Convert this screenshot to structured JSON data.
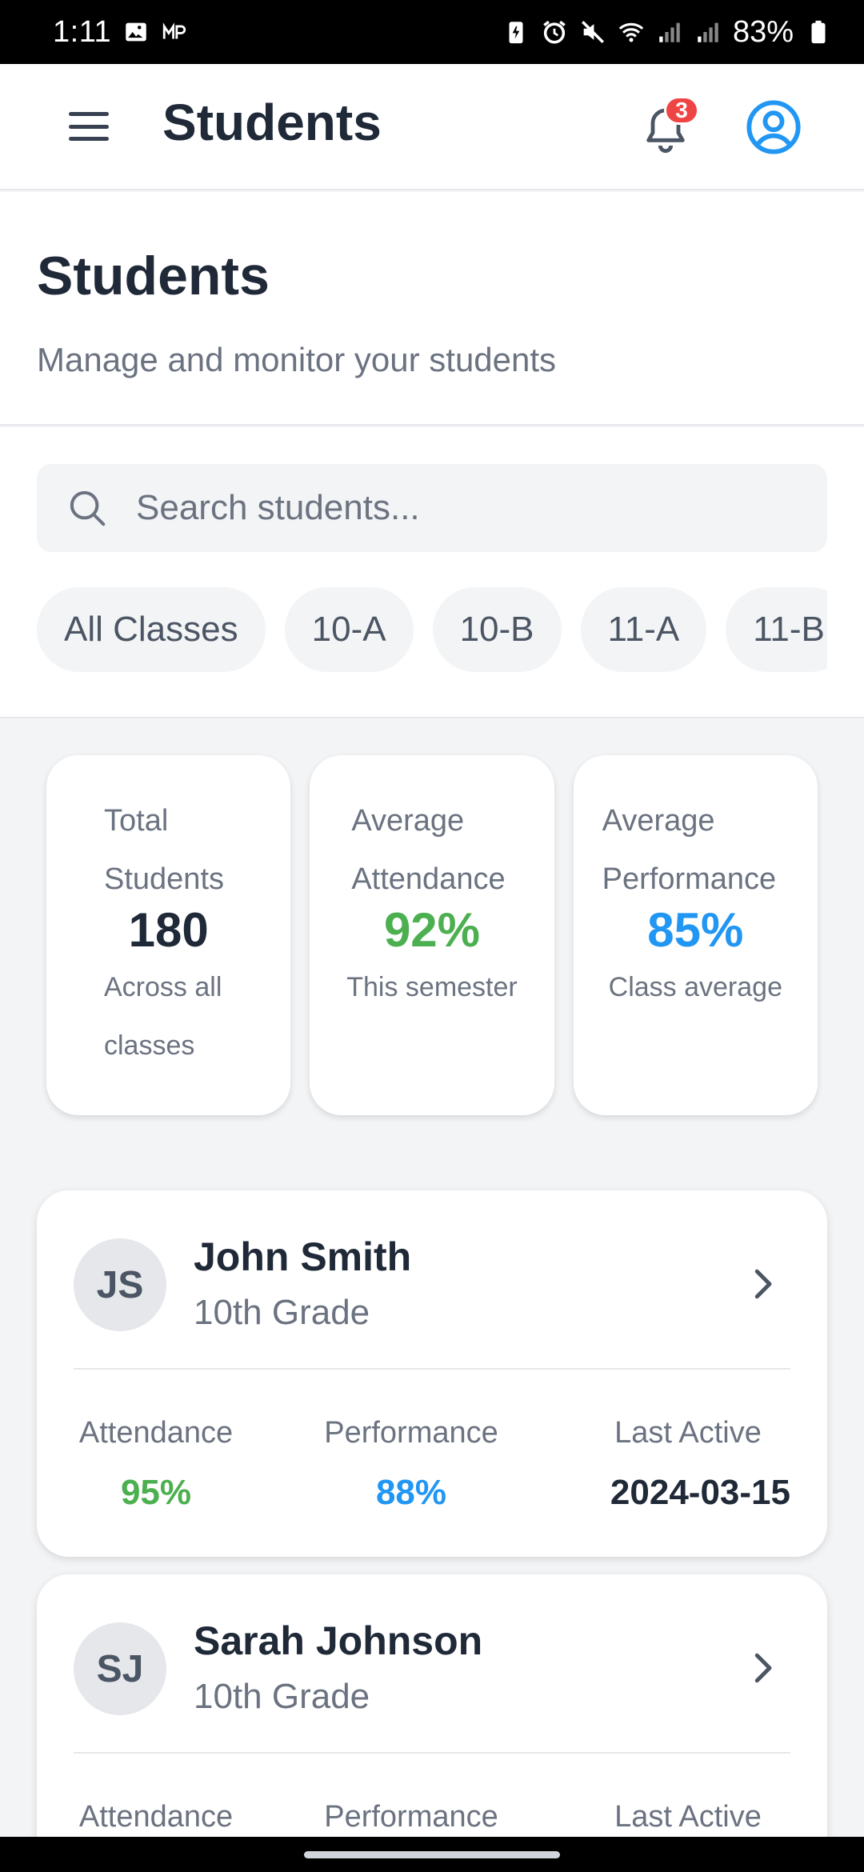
{
  "status_bar": {
    "time": "1:11",
    "battery": "83%",
    "icons": [
      "gallery-icon",
      "vpn-icon",
      "battery-saver-icon",
      "alarm-icon",
      "mute-icon",
      "wifi-icon",
      "signal-icon",
      "signal-icon",
      "battery-icon"
    ]
  },
  "app_bar": {
    "title": "Students",
    "notification_count": "3"
  },
  "header": {
    "title": "Students",
    "subtitle": "Manage and monitor your students"
  },
  "search": {
    "placeholder": "Search students...",
    "value": ""
  },
  "filters": [
    "All Classes",
    "10-A",
    "10-B",
    "11-A",
    "11-B"
  ],
  "stats": {
    "total": {
      "label_line1": "Total",
      "label_line2": "Students",
      "value": "180",
      "note_line1": "Across all",
      "note_line2": "classes"
    },
    "attendance": {
      "label_line1": "Average",
      "label_line2": "Attendance",
      "value": "92%",
      "note": "This semester"
    },
    "performance": {
      "label_line1": "Average",
      "label_line2": "Performance",
      "value": "85%",
      "note": "Class average"
    }
  },
  "metric_labels": {
    "attendance": "Attendance",
    "performance": "Performance",
    "last_active": "Last Active"
  },
  "students": [
    {
      "initials": "JS",
      "name": "John Smith",
      "grade": "10th Grade",
      "attendance": "95%",
      "performance": "88%",
      "last_active": "2024-03-15"
    },
    {
      "initials": "SJ",
      "name": "Sarah Johnson",
      "grade": "10th Grade",
      "attendance": "",
      "performance": "",
      "last_active": ""
    }
  ],
  "colors": {
    "accent_green": "#4caf50",
    "accent_blue": "#2196f3",
    "badge_red": "#ef4444",
    "text_dark": "#1f2937",
    "text_muted": "#6b7280"
  }
}
